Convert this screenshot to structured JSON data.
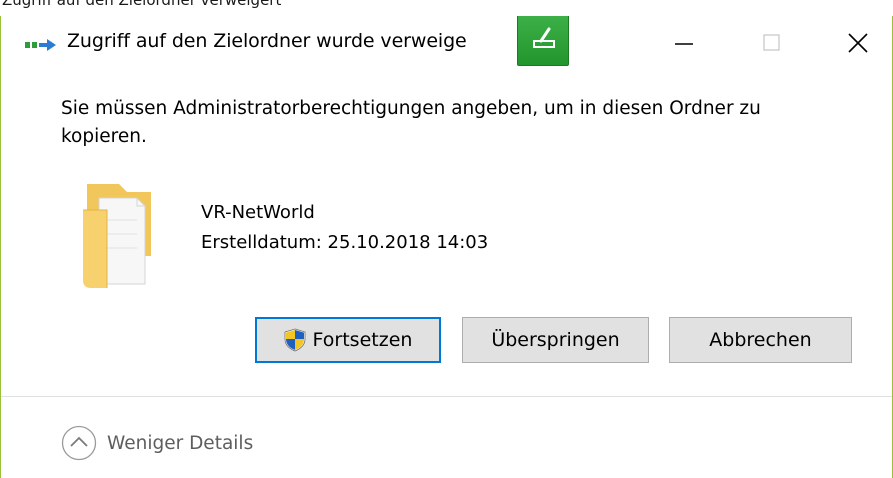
{
  "above_text": "Zugriff auf den Zielordner verweigert",
  "window": {
    "title": "Zugriff auf den Zielordner wurde verweige"
  },
  "message": "Sie müssen Administratorberechtigungen angeben, um in diesen Ordner zu kopieren.",
  "file": {
    "name": "VR-NetWorld",
    "date_label": "Erstelldatum:",
    "date_value": "25.10.2018 14:03"
  },
  "buttons": {
    "continue": "Fortsetzen",
    "skip": "Überspringen",
    "cancel": "Abbrechen"
  },
  "footer": {
    "details_label": "Weniger Details"
  },
  "icons": {
    "title": "copy-arrow-icon",
    "overlay": "tool-icon",
    "file": "folder-icon",
    "uac": "uac-shield-icon",
    "details": "chevron-up-circle-icon"
  },
  "colors": {
    "window_border": "#98c23a",
    "overlay_green": "#2aa236",
    "default_button_border": "#0078d7",
    "button_bg": "#e1e1e1",
    "footer_text": "#5e5e5e"
  }
}
